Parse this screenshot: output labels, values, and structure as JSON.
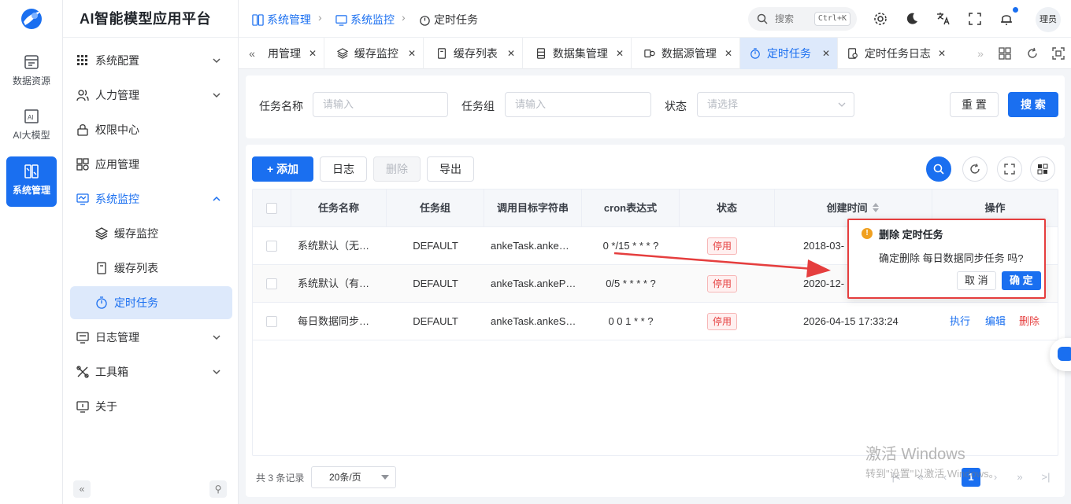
{
  "app": {
    "title": "AI智能模型应用平台"
  },
  "rail": [
    {
      "label": "数据资源",
      "icon": "database-icon"
    },
    {
      "label": "AI大模型",
      "icon": "ai-chip-icon"
    },
    {
      "label": "系统管理",
      "icon": "system-icon",
      "active": true
    }
  ],
  "menu": {
    "system_config": "系统配置",
    "hr": "人力管理",
    "permission": "权限中心",
    "app_manage": "应用管理",
    "monitor": "系统监控",
    "cache_monitor": "缓存监控",
    "cache_list": "缓存列表",
    "scheduled_task": "定时任务",
    "log_manage": "日志管理",
    "toolbox": "工具箱",
    "about": "关于"
  },
  "breadcrumb": {
    "level1": "系统管理",
    "level2": "系统监控",
    "level3": "定时任务"
  },
  "header": {
    "search_label": "搜索",
    "shortcut": "Ctrl+K",
    "user": "理员"
  },
  "tabs": [
    {
      "label": "用管理"
    },
    {
      "label": "缓存监控"
    },
    {
      "label": "缓存列表"
    },
    {
      "label": "数据集管理"
    },
    {
      "label": "数据源管理"
    },
    {
      "label": "定时任务",
      "active": true
    },
    {
      "label": "定时任务日志"
    }
  ],
  "filter": {
    "name_label": "任务名称",
    "name_placeholder": "请输入",
    "group_label": "任务组",
    "group_placeholder": "请输入",
    "status_label": "状态",
    "status_placeholder": "请选择",
    "reset": "重 置",
    "search": "搜 索"
  },
  "toolbar": {
    "add": "+ 添加",
    "log": "日志",
    "delete": "删除",
    "export": "导出"
  },
  "table": {
    "columns": [
      "任务名称",
      "任务组",
      "调用目标字符串",
      "cron表达式",
      "状态",
      "创建时间",
      "操作"
    ],
    "rows": [
      {
        "name": "系统默认（无…",
        "group": "DEFAULT",
        "target": "ankeTask.anke…",
        "cron": "0 */15 * * * ?",
        "status": "停用",
        "created": "2018-03-"
      },
      {
        "name": "系统默认（有…",
        "group": "DEFAULT",
        "target": "ankeTask.ankeP…",
        "cron": "0/5 * * * * ?",
        "status": "停用",
        "created": "2020-12-"
      },
      {
        "name": "每日数据同步…",
        "group": "DEFAULT",
        "target": "ankeTask.ankeS…",
        "cron": "0 0 1 * * ?",
        "status": "停用",
        "created": "2026-04-15 17:33:24"
      }
    ],
    "actions": {
      "run": "执行",
      "edit": "编辑",
      "delete": "删除"
    }
  },
  "pagination": {
    "total": "共 3 条记录",
    "page_size": "20条/页",
    "current_page": "1"
  },
  "popconfirm": {
    "title": "删除 定时任务",
    "message": "确定删除 每日数据同步任务 吗?",
    "cancel": "取 消",
    "confirm": "确 定"
  },
  "watermark": {
    "line1": "激活 Windows",
    "line2": "转到\"设置\"以激活 Windows。"
  },
  "colors": {
    "primary": "#1a6ff0",
    "danger": "#e64242",
    "annotation": "#e53e3e"
  }
}
